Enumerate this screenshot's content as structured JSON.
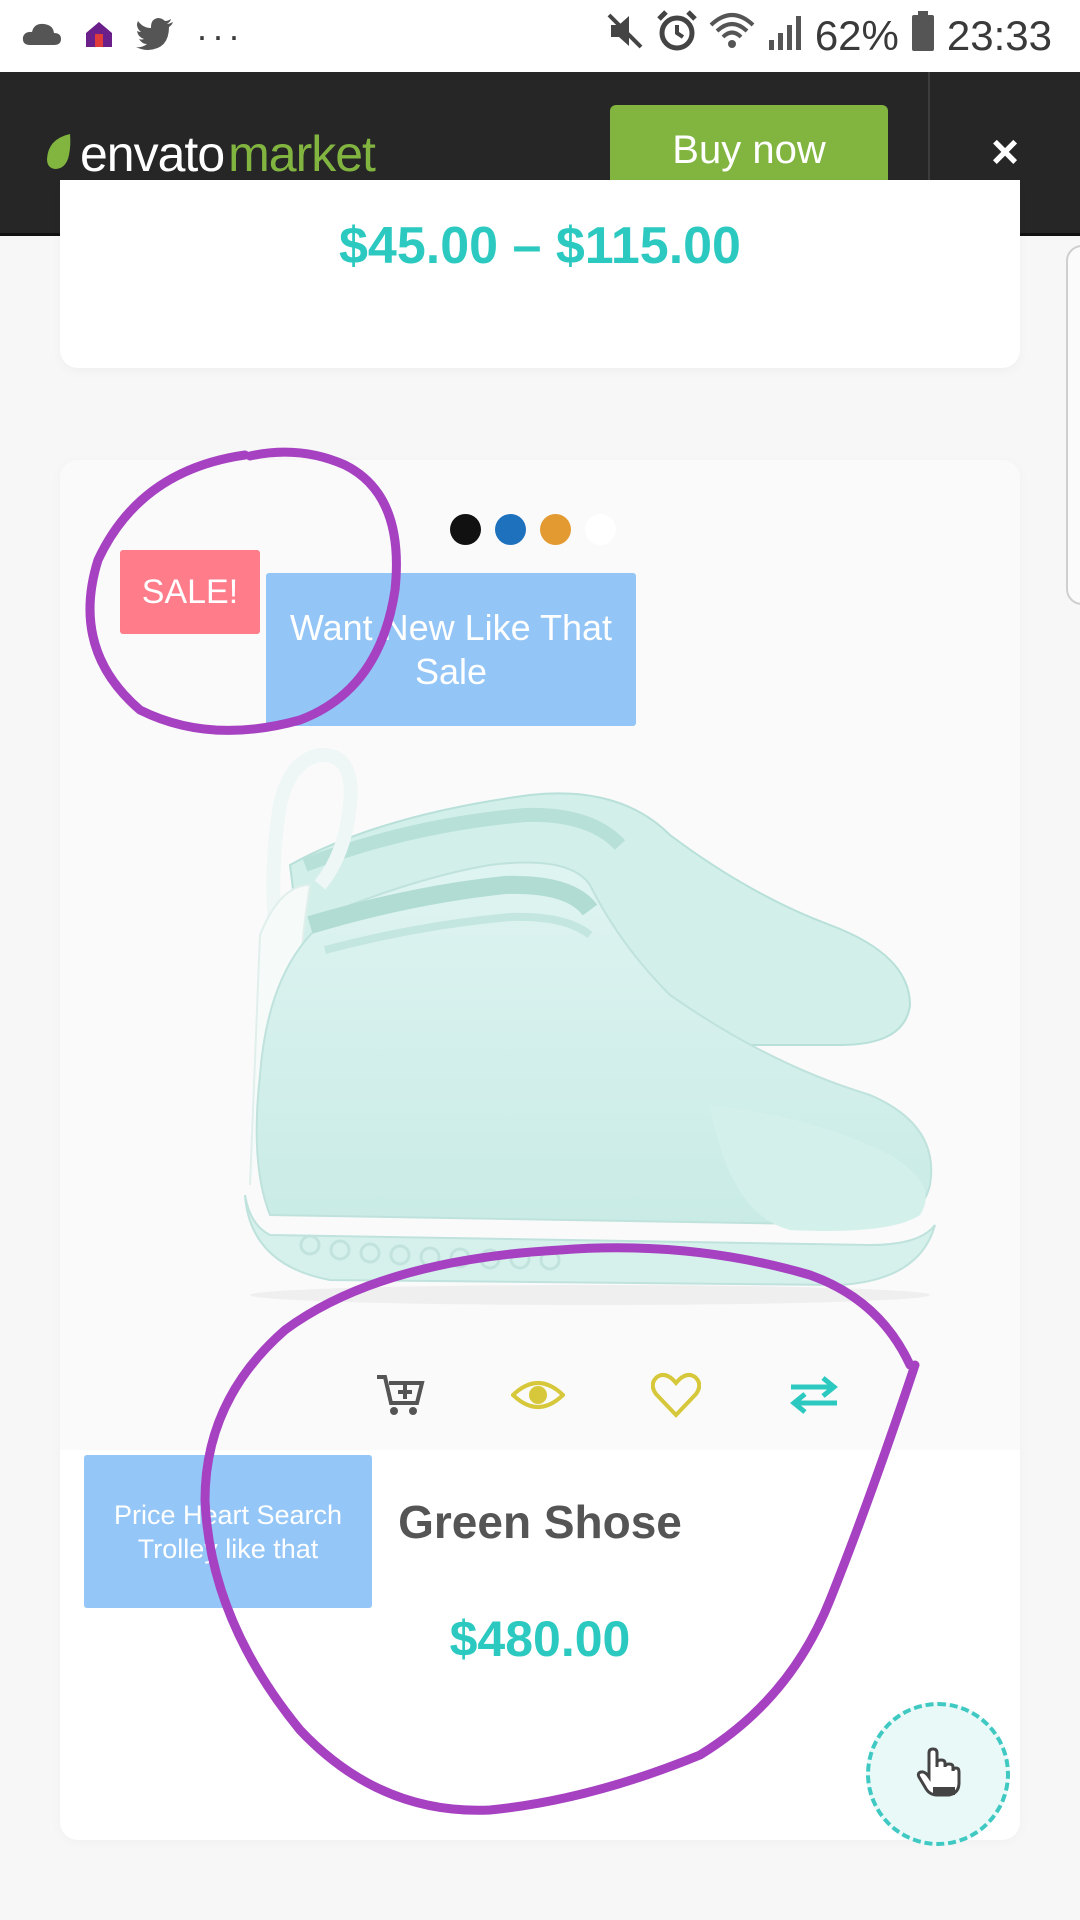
{
  "status_bar": {
    "battery": "62%",
    "time": "23:33",
    "notification_icons": [
      "cloud-icon",
      "app-icon",
      "twitter-icon",
      "more-dots-icon"
    ],
    "system_icons": [
      "mute-icon",
      "alarm-icon",
      "wifi-icon",
      "signal-icon",
      "battery-icon"
    ]
  },
  "header": {
    "logo_text_1": "envato",
    "logo_text_2": "market",
    "buy_label": "Buy now",
    "close_label": "×",
    "brand_color": "#82b540"
  },
  "previous_item": {
    "price_range": "$45.00 – $115.00"
  },
  "product": {
    "swatches": [
      "#111111",
      "#1e72bd",
      "#e39b31",
      "#ffffff"
    ],
    "sale_label": "SALE!",
    "name": "Green Shose",
    "price": "$480.00",
    "actions": [
      "cart-plus-icon",
      "eye-icon",
      "heart-icon",
      "compare-arrows-icon"
    ]
  },
  "annotations": {
    "sale_note": "Want New Like That Sale",
    "actions_note": "Price Heart Search Trolley like that",
    "highlight_color": "#a641c2"
  },
  "fab_icon": "hand-pointer-icon"
}
